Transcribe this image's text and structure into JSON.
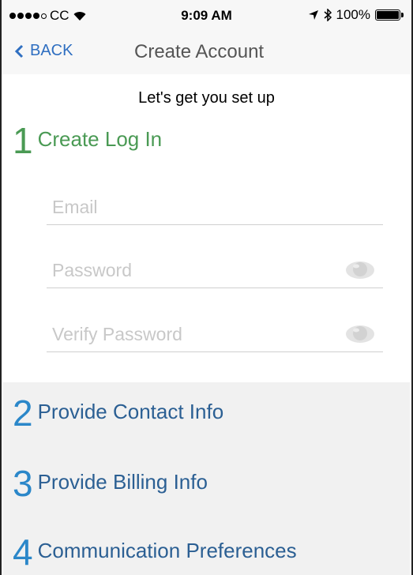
{
  "status_bar": {
    "carrier": "CC",
    "time": "9:09 AM",
    "battery": "100%"
  },
  "nav": {
    "back_label": "BACK",
    "title": "Create Account"
  },
  "tagline": "Let's get you set up",
  "steps": [
    {
      "number": "1",
      "label": "Create Log In"
    },
    {
      "number": "2",
      "label": "Provide Contact Info"
    },
    {
      "number": "3",
      "label": "Provide Billing Info"
    },
    {
      "number": "4",
      "label": "Communication Preferences"
    }
  ],
  "form": {
    "email_placeholder": "Email",
    "password_placeholder": "Password",
    "verify_placeholder": "Verify Password"
  },
  "colors": {
    "active_step": "#4a9a54",
    "step_number": "#2b87c9",
    "step_label": "#2b5f93",
    "link": "#2f6fc1"
  }
}
